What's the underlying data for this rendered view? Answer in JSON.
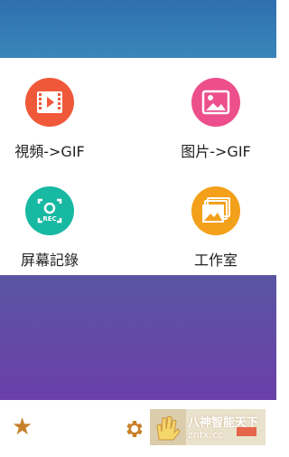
{
  "colors": {
    "header": "#3a86b8",
    "video_to_gif": "#f0583a",
    "image_to_gif": "#ec4f8c",
    "screen_record": "#18b9a2",
    "studio": "#f3a01b",
    "panel": "#6b3fa9",
    "accent": "#c7802a"
  },
  "menu": {
    "items": [
      {
        "label": "視頻->GIF",
        "icon": "film-play-icon"
      },
      {
        "label": "图片->GIF",
        "icon": "image-icon"
      },
      {
        "label": "屏幕記錄",
        "icon": "record-icon",
        "badge": "REC"
      },
      {
        "label": "工作室",
        "icon": "gallery-stack-icon"
      }
    ]
  },
  "bottom_bar": {
    "icons": [
      "star-icon",
      "settings-gear-icon"
    ]
  },
  "watermark": {
    "line1": "八神智能天下",
    "line2": "zntx.cc"
  }
}
